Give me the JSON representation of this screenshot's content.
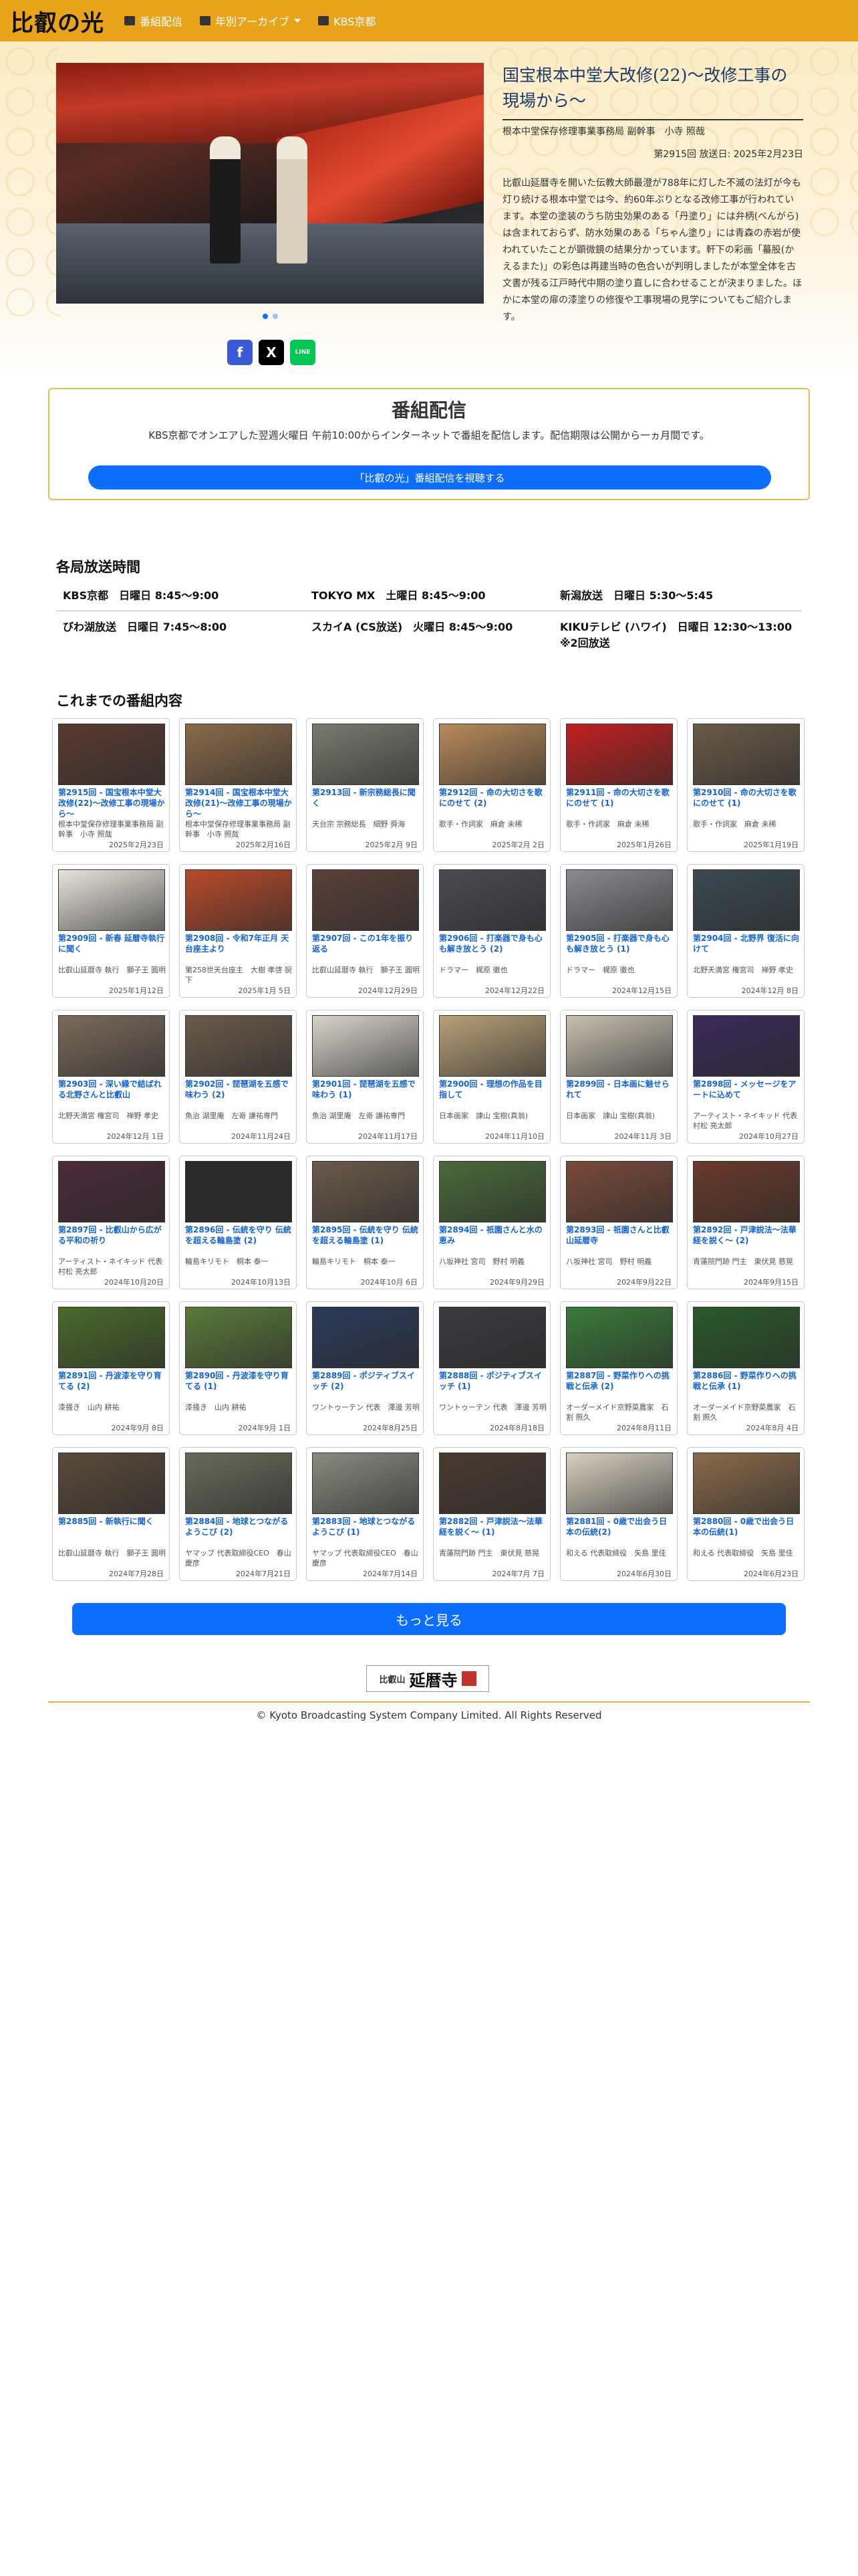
{
  "nav": {
    "brand": "比叡の光",
    "links": [
      "番組配信",
      "年別アーカイブ",
      "KBS京都"
    ]
  },
  "hero": {
    "title": "国宝根本中堂大改修(22)〜改修工事の現場から〜",
    "subtitle": "根本中堂保存修理事業事務局 副幹事　小寺 照哉",
    "episode": "第2915回 放送日: 2025年2月23日",
    "body": "比叡山延暦寺を開いた伝教大師最澄が788年に灯した不滅の法灯が今も灯り続ける根本中堂では今、約60年ぶりとなる改修工事が行われています。本堂の塗装のうち防虫効果のある「丹塗り」には弁柄(べんがら)は含まれておらず、防水効果のある「ちゃん塗り」には青森の赤岩が使われていたことが顕微鏡の結果分かっています。軒下の彩画「蟇股(かえるまた)」の彩色は再建当時の色合いが判明しましたが本堂全体を古文書が残る江戸時代中期の塗り直しに合わせることが決まりました。ほかに本堂の扉の漆塗りの修復や工事現場の見学についてもご紹介します。"
  },
  "share": [
    "f",
    "X",
    "LINE"
  ],
  "panel": {
    "title": "番組配信",
    "text": "KBS京都でオンエアした翌週火曜日 午前10:00からインターネットで番組を配信します。配信期限は公開から一ヵ月間です。",
    "button": "「比叡の光」番組配信を視聴する"
  },
  "schedule": {
    "heading": "各局放送時間",
    "row1": [
      "KBS京都　日曜日 8:45〜9:00",
      "TOKYO MX　土曜日 8:45〜9:00",
      "新潟放送　日曜日 5:30〜5:45"
    ],
    "row2": [
      "びわ湖放送　日曜日 7:45〜8:00",
      "スカイA (CS放送)　火曜日 8:45〜9:00",
      "KIKUテレビ (ハワイ)　日曜日 12:30〜13:00"
    ],
    "note": "※2回放送"
  },
  "archive_heading": "これまでの番組内容",
  "episodes": [
    {
      "title": "第2915回 - 国宝根本中堂大改修(22)〜改修工事の現場から〜",
      "guest": "根本中堂保存修理事業事務局 副幹事　小寺 照哉",
      "date": "2025年2月23日",
      "color": "#5a3a30"
    },
    {
      "title": "第2914回 - 国宝根本中堂大改修(21)〜改修工事の現場から〜",
      "guest": "根本中堂保存修理事業事務局 副幹事　小寺 照哉",
      "date": "2025年2月16日",
      "color": "#8a6a4a"
    },
    {
      "title": "第2913回 - 新宗務総長に聞く",
      "guest": "天台宗 宗務総長　細野 舜海",
      "date": "2025年2月 9日",
      "color": "#7a7a70"
    },
    {
      "title": "第2912回 - 命の大切さを歌にのせて (2)",
      "guest": "歌手・作詞家　麻倉 未稀",
      "date": "2025年2月 2日",
      "color": "#b88a5a"
    },
    {
      "title": "第2911回 - 命の大切さを歌にのせて (1)",
      "guest": "歌手・作詞家　麻倉 未稀",
      "date": "2025年1月26日",
      "color": "#c02020"
    },
    {
      "title": "第2910回 - 命の大切さを歌にのせて (1)",
      "guest": "歌手・作詞家　麻倉 未稀",
      "date": "2025年1月19日",
      "color": "#6a5a48"
    },
    {
      "title": "第2909回 - 新春 延暦寺執行に聞く",
      "guest": "比叡山延暦寺 執行　獅子王 圓明",
      "date": "2025年1月12日",
      "color": "#e8e4dc"
    },
    {
      "title": "第2908回 - 令和7年正月 天台座主より",
      "guest": "第258世天台座主　大樹 孝啓 猊下",
      "date": "2025年1月 5日",
      "color": "#b84a2a"
    },
    {
      "title": "第2907回 - この1年を振り返る",
      "guest": "比叡山延暦寺 執行　獅子王 圓明",
      "date": "2024年12月29日",
      "color": "#5a4038"
    },
    {
      "title": "第2906回 - 打楽器で身も心も解き放とう (2)",
      "guest": "ドラマー　梶原 徹也",
      "date": "2024年12月22日",
      "color": "#4a4a52"
    },
    {
      "title": "第2905回 - 打楽器で身も心も解き放とう (1)",
      "guest": "ドラマー　梶原 徹也",
      "date": "2024年12月15日",
      "color": "#8a8a90"
    },
    {
      "title": "第2904回 - 北野界 復活に向けて",
      "guest": "北野天満宮 権宮司　禅野 孝史",
      "date": "2024年12月 8日",
      "color": "#3a4a52"
    },
    {
      "title": "第2903回 - 深い縁で結ばれる北野さんと比叡山",
      "guest": "北野天満宮 権宮司　禅野 孝史",
      "date": "2024年12月 1日",
      "color": "#7a6a5a"
    },
    {
      "title": "第2902回 - 琵琶湖を五感で味わう (2)",
      "guest": "魚治 湖里庵　左嵜 謙祐専門",
      "date": "2024年11月24日",
      "color": "#6a5a4a"
    },
    {
      "title": "第2901回 - 琵琶湖を五感で味わう (1)",
      "guest": "魚治 湖里庵　左嵜 謙祐専門",
      "date": "2024年11月17日",
      "color": "#d8d4cc"
    },
    {
      "title": "第2900回 - 理想の作品を目指して",
      "guest": "日本画家　諫山 宝樹(真翁)",
      "date": "2024年11月10日",
      "color": "#b8a078"
    },
    {
      "title": "第2899回 - 日本画に魅せられて",
      "guest": "日本画家　諫山 宝樹(真翁)",
      "date": "2024年11月 3日",
      "color": "#c8c0b0"
    },
    {
      "title": "第2898回 - メッセージをアートに込めて",
      "guest": "アーティスト・ネイキッド 代表　村松 亮太郎",
      "date": "2024年10月27日",
      "color": "#3a2a5a"
    },
    {
      "title": "第2897回 - 比叡山から広がる平和の祈り",
      "guest": "アーティスト・ネイキッド 代表　村松 亮太郎",
      "date": "2024年10月20日",
      "color": "#4a2a3a"
    },
    {
      "title": "第2896回 - 伝統を守り 伝統を超える輪島塗 (2)",
      "guest": "輪島キリモト　桐本 泰一",
      "date": "2024年10月13日",
      "color": "#2a2a2a"
    },
    {
      "title": "第2895回 - 伝統を守り 伝統を超える輪島塗 (1)",
      "guest": "輪島キリモト　桐本 泰一",
      "date": "2024年10月 6日",
      "color": "#6a5a4a"
    },
    {
      "title": "第2894回 - 祇園さんと水の恵み",
      "guest": "八坂神社 宮司　野村 明義",
      "date": "2024年9月29日",
      "color": "#4a6a3a"
    },
    {
      "title": "第2893回 - 祇園さんと比叡山延暦寺",
      "guest": "八坂神社 宮司　野村 明義",
      "date": "2024年9月22日",
      "color": "#7a4a3a"
    },
    {
      "title": "第2892回 - 戸津説法〜法華経を説く〜 (2)",
      "guest": "青蓮院門跡 門主　東伏見 慈晃",
      "date": "2024年9月15日",
      "color": "#6a3a2a"
    },
    {
      "title": "第2891回 - 丹波漆を守り育てる (2)",
      "guest": "漆掻き　山内 耕祐",
      "date": "2024年9月 8日",
      "color": "#4a6a2a"
    },
    {
      "title": "第2890回 - 丹波漆を守り育てる (1)",
      "guest": "漆掻き　山内 耕祐",
      "date": "2024年9月 1日",
      "color": "#5a7a3a"
    },
    {
      "title": "第2889回 - ポジティブスイッチ (2)",
      "guest": "ワントゥーテン 代表　澤邊 芳明",
      "date": "2024年8月25日",
      "color": "#2a3a5a"
    },
    {
      "title": "第2888回 - ポジティブスイッチ (1)",
      "guest": "ワントゥーテン 代表　澤邊 芳明",
      "date": "2024年8月18日",
      "color": "#3a3a40"
    },
    {
      "title": "第2887回 - 野菜作りへの挑戦と伝承 (2)",
      "guest": "オーダーメイド京野菜農家　石割 照久",
      "date": "2024年8月11日",
      "color": "#3a7a3a"
    },
    {
      "title": "第2886回 - 野菜作りへの挑戦と伝承 (1)",
      "guest": "オーダーメイド京野菜農家　石割 照久",
      "date": "2024年8月 4日",
      "color": "#2a5a2a"
    },
    {
      "title": "第2885回 - 新執行に聞く",
      "guest": "比叡山延暦寺 執行　獅子王 圓明",
      "date": "2024年7月28日",
      "color": "#5a4a3a"
    },
    {
      "title": "第2884回 - 地球とつながるようこび (2)",
      "guest": "ヤマップ 代表取締役CEO　春山 慶彦",
      "date": "2024年7月21日",
      "color": "#6a6a5a"
    },
    {
      "title": "第2883回 - 地球とつながるようこび (1)",
      "guest": "ヤマップ 代表取締役CEO　春山 慶彦",
      "date": "2024年7月14日",
      "color": "#8a8a80"
    },
    {
      "title": "第2882回 - 戸津説法〜法華経を説く〜 (1)",
      "guest": "青蓮院門跡 門主　東伏見 慈晃",
      "date": "2024年7月 7日",
      "color": "#4a3a30"
    },
    {
      "title": "第2881回 - 0歳で出会う日本の伝統(2)",
      "guest": "和える 代表取締役　矢島 里佳",
      "date": "2024年6月30日",
      "color": "#d8d0c0"
    },
    {
      "title": "第2880回 - 0歳で出会う日本の伝統(1)",
      "guest": "和える 代表取締役　矢島 里佳",
      "date": "2024年6月23日",
      "color": "#8a6a4a"
    }
  ],
  "more_button": "もっと見る",
  "footer": {
    "logo_small": "比叡山",
    "logo_main": "延暦寺",
    "copyright": "© Kyoto Broadcasting System Company Limited. All Rights Reserved"
  }
}
